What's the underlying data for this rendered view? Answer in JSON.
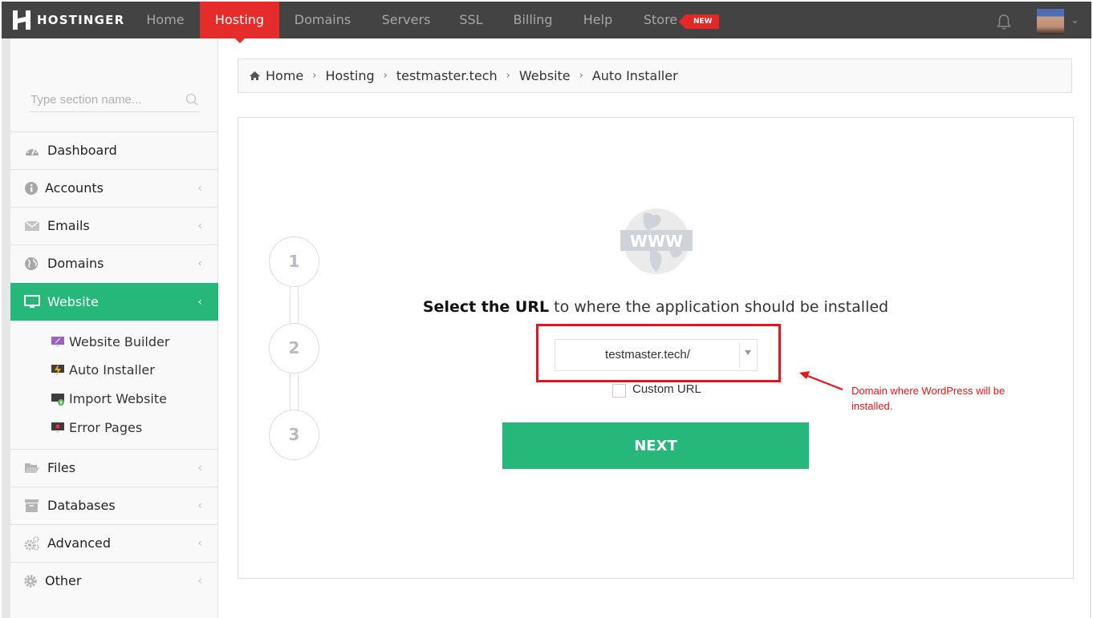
{
  "brand": {
    "name": "HOSTINGER",
    "accent": "#e62b2b",
    "green": "#26b77b"
  },
  "topnav": {
    "items": [
      {
        "label": "Home",
        "active": false
      },
      {
        "label": "Hosting",
        "active": true
      },
      {
        "label": "Domains",
        "active": false
      },
      {
        "label": "Servers",
        "active": false
      },
      {
        "label": "SSL",
        "active": false
      },
      {
        "label": "Billing",
        "active": false
      },
      {
        "label": "Help",
        "active": false
      },
      {
        "label": "Store",
        "active": false
      }
    ],
    "store_badge": "NEW",
    "notifications_icon": "bell-icon",
    "user_menu_icon": "chevron-down-icon"
  },
  "sidebar": {
    "search_placeholder": "Type section name...",
    "items": [
      {
        "label": "Dashboard",
        "icon": "dashboard-icon",
        "has_chevron": false
      },
      {
        "label": "Accounts",
        "icon": "info-icon",
        "has_chevron": true
      },
      {
        "label": "Emails",
        "icon": "envelope-icon",
        "has_chevron": true
      },
      {
        "label": "Domains",
        "icon": "globe-icon",
        "has_chevron": true
      },
      {
        "label": "Website",
        "icon": "monitor-icon",
        "has_chevron": true,
        "active": true
      },
      {
        "label": "Files",
        "icon": "folder-open-icon",
        "has_chevron": true
      },
      {
        "label": "Databases",
        "icon": "archive-icon",
        "has_chevron": true
      },
      {
        "label": "Advanced",
        "icon": "gears-icon",
        "has_chevron": true
      },
      {
        "label": "Other",
        "icon": "gear-icon",
        "has_chevron": true
      }
    ],
    "subitems": [
      {
        "label": "Website Builder",
        "icon": "website-builder-icon"
      },
      {
        "label": "Auto Installer",
        "icon": "auto-installer-icon"
      },
      {
        "label": "Import Website",
        "icon": "import-website-icon"
      },
      {
        "label": "Error Pages",
        "icon": "error-pages-icon"
      }
    ],
    "chevron": "‹"
  },
  "breadcrumb": {
    "items": [
      "Home",
      "Hosting",
      "testmaster.tech",
      "Website",
      "Auto Installer"
    ],
    "separator": "›"
  },
  "wizard": {
    "steps": [
      "1",
      "2",
      "3"
    ],
    "current_step": 2,
    "icon": "www-globe-icon",
    "icon_text": "WWW",
    "heading_bold": "Select the URL",
    "heading_rest": " to where the application should be installed",
    "url_select": {
      "value": "testmaster.tech/"
    },
    "custom_url": {
      "label": "Custom URL",
      "checked": false
    },
    "next_label": "NEXT"
  },
  "annotation": {
    "text": "Domain where WordPress will be installed.",
    "color": "#e8141b"
  }
}
